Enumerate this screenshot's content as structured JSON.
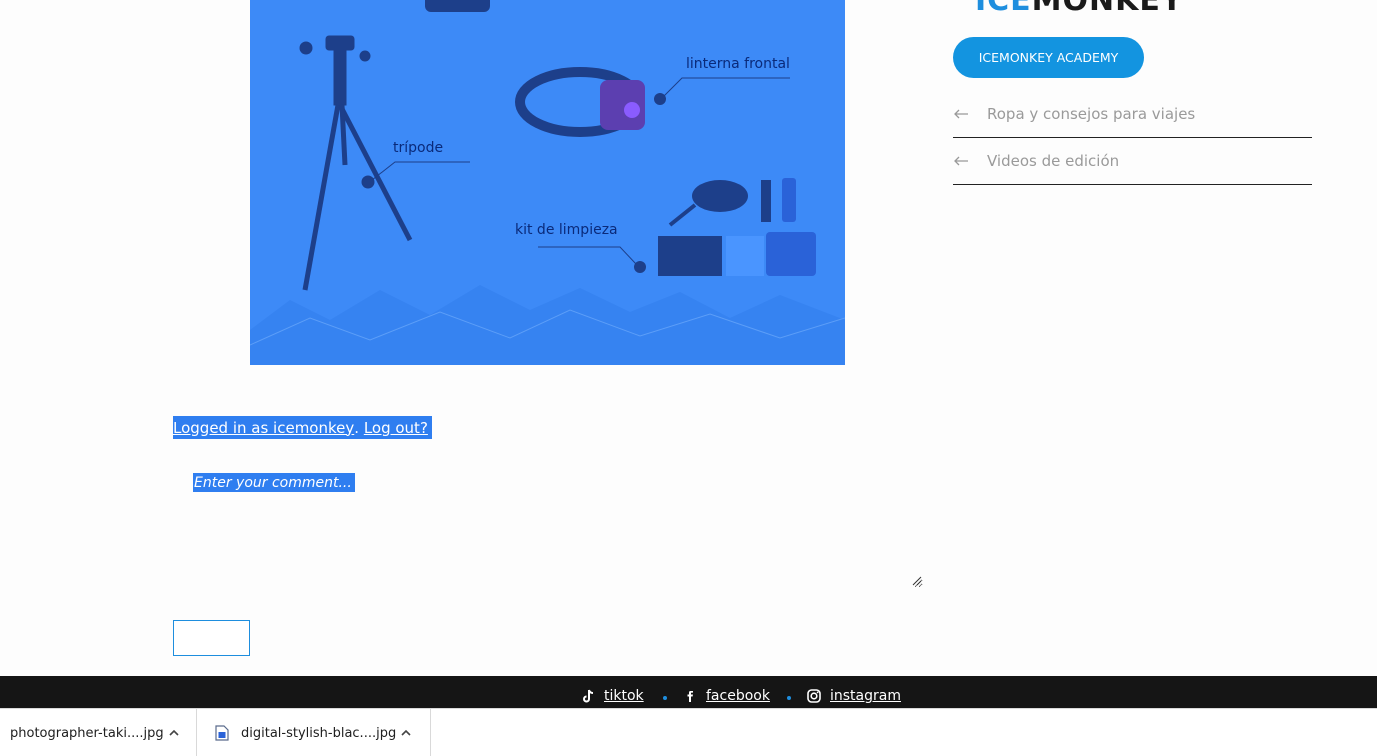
{
  "hero": {
    "labels": {
      "linterna": "linterna frontal",
      "tripode": "trípode",
      "limpieza": "kit de limpieza"
    }
  },
  "sidebar": {
    "brand_ice": "ICE",
    "brand_monkey": "MONKEY",
    "academy_label": "ICEMONKEY ACADEMY",
    "links": [
      {
        "label": "Ropa y consejos para viajes",
        "icon": "arrow-left-icon"
      },
      {
        "label": "Videos de edición",
        "icon": "arrow-left-icon"
      }
    ]
  },
  "comment": {
    "logged_in_text": "Logged in as icemonkey",
    "separator": ".",
    "logout_text": "Log out?",
    "placeholder": "Enter your comment..."
  },
  "footer": {
    "social": [
      {
        "label": "tiktok",
        "icon": "tiktok-icon"
      },
      {
        "label": "facebook",
        "icon": "facebook-icon"
      },
      {
        "label": "instagram",
        "icon": "instagram-icon"
      }
    ]
  },
  "downloads": [
    {
      "name": "photographer-taki....jpg"
    },
    {
      "name": "digital-stylish-blac....jpg"
    }
  ],
  "colors": {
    "accent": "#1394e0",
    "hero_bg": "#3d8af7",
    "selection": "#2f7ef0",
    "footer_bg": "#151515"
  }
}
